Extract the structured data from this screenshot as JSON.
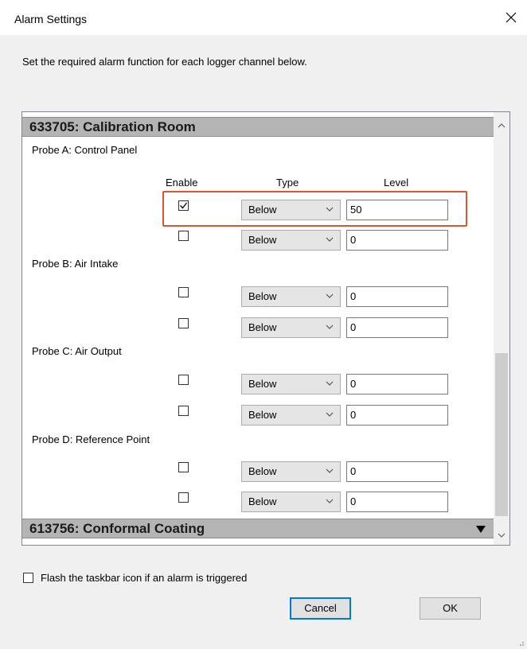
{
  "window": {
    "title": "Alarm Settings"
  },
  "instruction": "Set the required alarm function for each logger channel below.",
  "groups": [
    {
      "header": "633705: Calibration Room",
      "columns": {
        "enable": "Enable",
        "type": "Type",
        "level": "Level"
      },
      "probes": [
        {
          "label": "Probe A: Control Panel",
          "alarms": [
            {
              "enabled": true,
              "type": "Below",
              "level": "50"
            },
            {
              "enabled": false,
              "type": "Below",
              "level": "0"
            }
          ]
        },
        {
          "label": "Probe B: Air Intake",
          "alarms": [
            {
              "enabled": false,
              "type": "Below",
              "level": "0"
            },
            {
              "enabled": false,
              "type": "Below",
              "level": "0"
            }
          ]
        },
        {
          "label": "Probe C: Air Output",
          "alarms": [
            {
              "enabled": false,
              "type": "Below",
              "level": "0"
            },
            {
              "enabled": false,
              "type": "Below",
              "level": "0"
            }
          ]
        },
        {
          "label": "Probe D: Reference Point",
          "alarms": [
            {
              "enabled": false,
              "type": "Below",
              "level": "0"
            },
            {
              "enabled": false,
              "type": "Below",
              "level": "0"
            }
          ]
        }
      ]
    },
    {
      "header": "613756: Conformal Coating",
      "collapsed": true
    }
  ],
  "options": {
    "flash_taskbar_label": "Flash the taskbar icon if an alarm is triggered",
    "flash_taskbar_checked": false
  },
  "buttons": {
    "cancel": "Cancel",
    "ok": "OK"
  },
  "colors": {
    "highlight": "#e05234",
    "group_header": "#b4b4b4",
    "focus_border": "#0078d7"
  },
  "icons": {
    "close": "close-icon",
    "dropdown": "chevron-down-icon",
    "expand": "triangle-down-icon",
    "scroll_up": "chevron-up-icon",
    "scroll_down": "chevron-down-icon",
    "checkmark": "checkmark-icon"
  }
}
